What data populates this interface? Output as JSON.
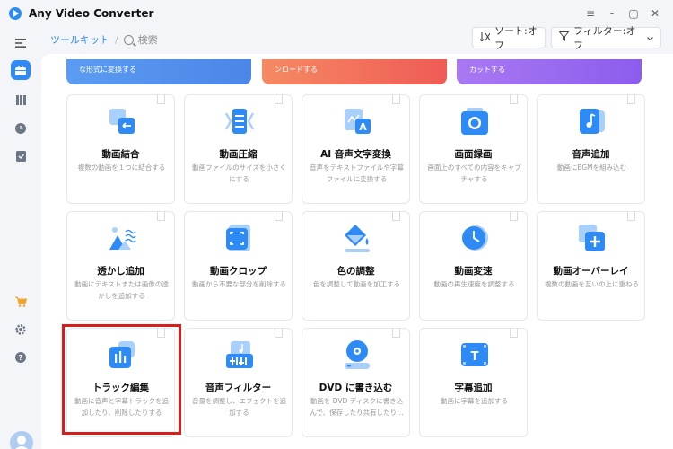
{
  "app": {
    "title": "Any Video Converter"
  },
  "window": {
    "minimize": "-",
    "restore": "▢",
    "close": "✕",
    "menu": "≡"
  },
  "breadcrumb": {
    "root": "ツールキット",
    "sep": "/",
    "search_label": "検索"
  },
  "toolbar": {
    "sort_label": "ソート:オフ",
    "filter_label": "フィルター:オフ"
  },
  "banners": [
    {
      "text": "な形式に変換する",
      "color": "#4e92f1"
    },
    {
      "text": "ンロードする",
      "color": "#f36f58"
    },
    {
      "text": "カットする",
      "color": "#9b68f0"
    }
  ],
  "cards": [
    {
      "title": "動画結合",
      "desc": "複数の動画を１つに結合する",
      "icon": "merge-icon"
    },
    {
      "title": "動画圧縮",
      "desc": "動画ファイルのサイズを小さくにする",
      "icon": "compress-icon"
    },
    {
      "title": "AI 音声文字変換",
      "desc": "音声をテキストファイルや字幕ファイルに変換する",
      "icon": "speech-to-text-icon"
    },
    {
      "title": "画面録画",
      "desc": "画面上のすべての内容をキャプチャする",
      "icon": "screen-record-icon"
    },
    {
      "title": "音声追加",
      "desc": "動画にBGMを組み込む",
      "icon": "audio-add-icon"
    },
    {
      "title": "透かし追加",
      "desc": "動画にテキストまたは画像の透かしを追加する",
      "icon": "watermark-icon"
    },
    {
      "title": "動画クロップ",
      "desc": "動画から不要な部分を削除する",
      "icon": "crop-icon"
    },
    {
      "title": "色の調整",
      "desc": "色を調整して動画を加工する",
      "icon": "color-adjust-icon"
    },
    {
      "title": "動画変速",
      "desc": "動画の再生速度を調整する",
      "icon": "speed-icon"
    },
    {
      "title": "動画オーバーレイ",
      "desc": "複数の動画を互いの上に重ねる",
      "icon": "overlay-icon"
    },
    {
      "title": "トラック編集",
      "desc": "動画に音声と字幕トラックを追加したり、削除したりする",
      "icon": "track-edit-icon"
    },
    {
      "title": "音声フィルター",
      "desc": "音量を調整し、エフェクトを追加する",
      "icon": "audio-filter-icon"
    },
    {
      "title": "DVD に書き込む",
      "desc": "動画を DVD ディスクに書き込んで、保存したり共有したり…",
      "icon": "dvd-burn-icon"
    },
    {
      "title": "字幕追加",
      "desc": "動画に字幕を追加する",
      "icon": "subtitle-add-icon"
    }
  ],
  "colors": {
    "accent": "#2e8bf5",
    "icon_light": "#a9d0fb",
    "icon_dark": "#2e8bf5",
    "highlight": "#d81d1d"
  }
}
